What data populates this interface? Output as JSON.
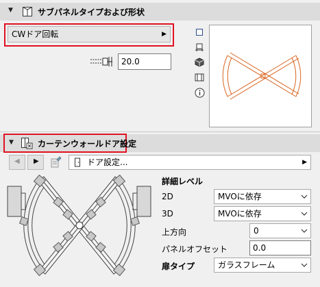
{
  "section1": {
    "title": "サブパネルタイプおよび形状",
    "type_dropdown_value": "CWドア回転",
    "width_value": "20.0",
    "preview_color": "#d9641e"
  },
  "section2": {
    "title": "カーテンウォールドア設定",
    "page_dropdown_value": "ドア設定...",
    "detail_level_label": "詳細レベル",
    "rows": [
      {
        "label": "2D",
        "value": "MVOに依存"
      },
      {
        "label": "3D",
        "value": "MVOに依存"
      },
      {
        "label": "上方向",
        "value": "0"
      },
      {
        "label": "パネルオフセット",
        "value": "0.0"
      },
      {
        "label": "扉タイプ",
        "value": "ガラスフレーム"
      }
    ]
  },
  "colors": {
    "highlight": "#e01020",
    "header_bg": "#dcdcdc"
  }
}
